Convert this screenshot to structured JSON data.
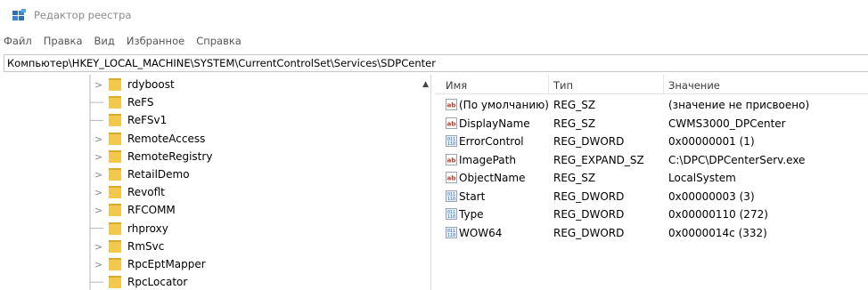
{
  "window": {
    "title": "Редактор реестра",
    "icon": "regedit-icon"
  },
  "menu": [
    "Файл",
    "Правка",
    "Вид",
    "Избранное",
    "Справка"
  ],
  "address_bar": {
    "path": "Компьютер\\HKEY_LOCAL_MACHINE\\SYSTEM\\CurrentControlSet\\Services\\SDPCenter"
  },
  "tree": {
    "items": [
      {
        "label": "rdyboost",
        "expandable": true
      },
      {
        "label": "ReFS",
        "expandable": false
      },
      {
        "label": "ReFSv1",
        "expandable": false
      },
      {
        "label": "RemoteAccess",
        "expandable": true
      },
      {
        "label": "RemoteRegistry",
        "expandable": true
      },
      {
        "label": "RetailDemo",
        "expandable": true
      },
      {
        "label": "Revoflt",
        "expandable": true
      },
      {
        "label": "RFCOMM",
        "expandable": true
      },
      {
        "label": "rhproxy",
        "expandable": false
      },
      {
        "label": "RmSvc",
        "expandable": true
      },
      {
        "label": "RpcEptMapper",
        "expandable": true
      },
      {
        "label": "RpcLocator",
        "expandable": false
      }
    ],
    "expander_glyph": ">"
  },
  "values_table": {
    "headers": {
      "name": "Имя",
      "type": "Тип",
      "data": "Значение"
    },
    "rows": [
      {
        "icon": "string-value-icon",
        "name": "(По умолчанию)",
        "type": "REG_SZ",
        "data": "(значение не присвоено)"
      },
      {
        "icon": "string-value-icon",
        "name": "DisplayName",
        "type": "REG_SZ",
        "data": "CWMS3000_DPCenter"
      },
      {
        "icon": "binary-value-icon",
        "name": "ErrorControl",
        "type": "REG_DWORD",
        "data": "0x00000001 (1)"
      },
      {
        "icon": "string-value-icon",
        "name": "ImagePath",
        "type": "REG_EXPAND_SZ",
        "data": "C:\\DPC\\DPCenterServ.exe"
      },
      {
        "icon": "string-value-icon",
        "name": "ObjectName",
        "type": "REG_SZ",
        "data": "LocalSystem"
      },
      {
        "icon": "binary-value-icon",
        "name": "Start",
        "type": "REG_DWORD",
        "data": "0x00000003 (3)"
      },
      {
        "icon": "binary-value-icon",
        "name": "Type",
        "type": "REG_DWORD",
        "data": "0x00000110 (272)"
      },
      {
        "icon": "binary-value-icon",
        "name": "WOW64",
        "type": "REG_DWORD",
        "data": "0x0000014c (332)"
      }
    ]
  },
  "colors": {
    "folder": "#f2c94c",
    "folder_dark": "#d9a92b",
    "string_icon": "#c0392b",
    "binary_icon": "#2e6fb5"
  }
}
